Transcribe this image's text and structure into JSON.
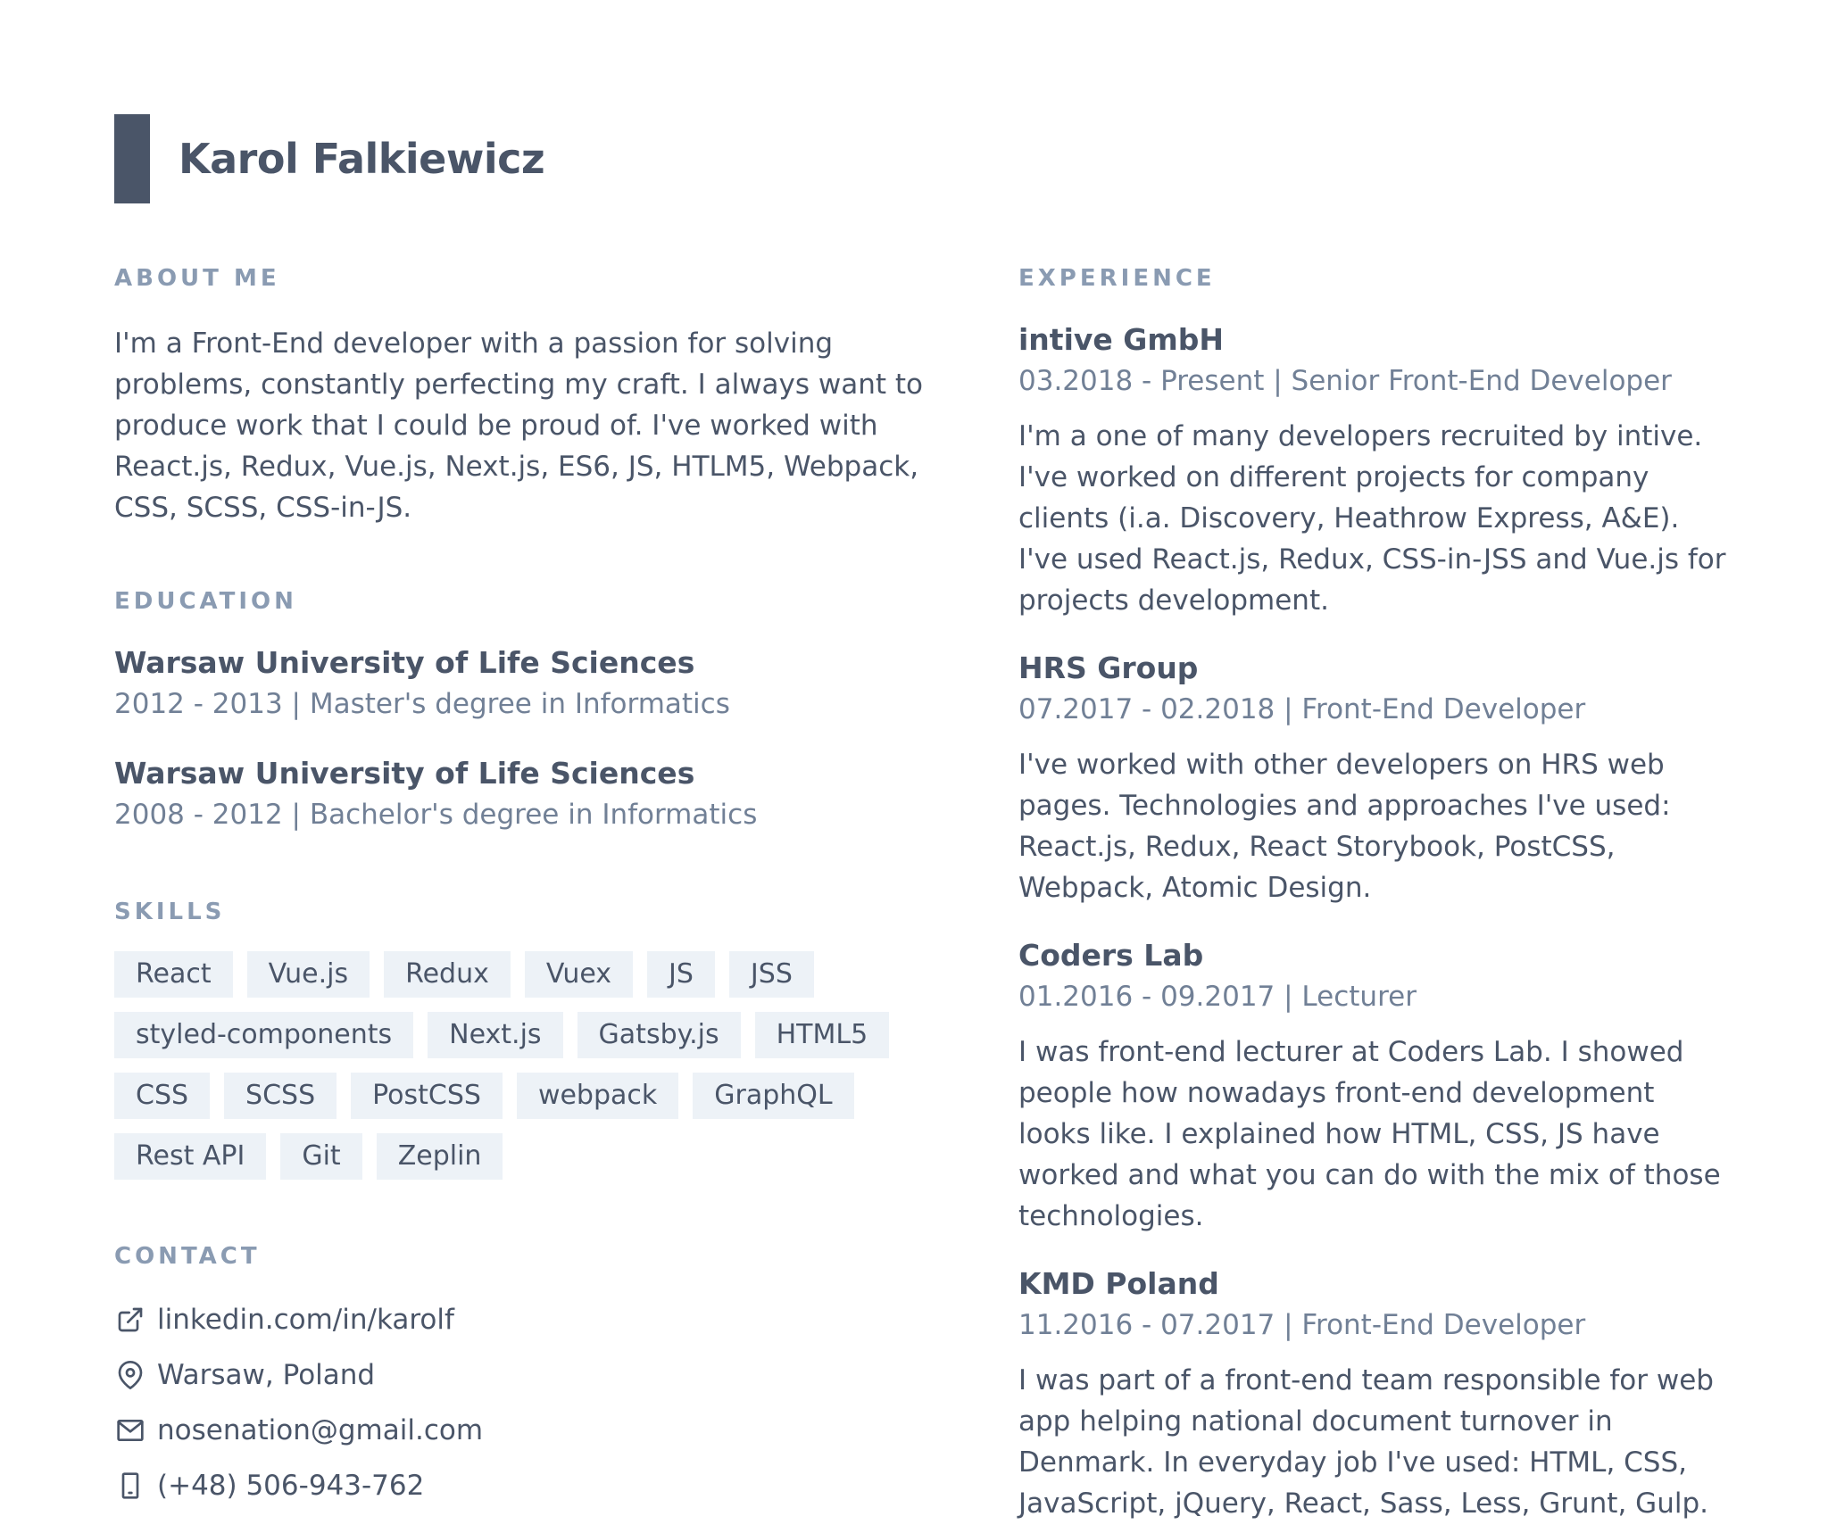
{
  "header": {
    "name": "Karol Falkiewicz"
  },
  "about": {
    "title": "About me",
    "text": "I'm a Front-End developer with a passion for solving problems, constantly perfecting my craft. I always want to produce work that I could be proud of. I've worked with React.js, Redux, Vue.js, Next.js, ES6, JS, HTLM5, Webpack, CSS, SCSS, CSS-in-JS."
  },
  "education": {
    "title": "Education",
    "items": [
      {
        "school": "Warsaw University of Life Sciences",
        "details": "2012 - 2013 | Master's degree in Informatics"
      },
      {
        "school": "Warsaw University of Life Sciences",
        "details": "2008 - 2012 | Bachelor's degree in Informatics"
      }
    ]
  },
  "skills": {
    "title": "Skills",
    "items": [
      "React",
      "Vue.js",
      "Redux",
      "Vuex",
      "JS",
      "JSS",
      "styled-components",
      "Next.js",
      "Gatsby.js",
      "HTML5",
      "CSS",
      "SCSS",
      "PostCSS",
      "webpack",
      "GraphQL",
      "Rest API",
      "Git",
      "Zeplin"
    ]
  },
  "contact": {
    "title": "Contact",
    "linkedin": "linkedin.com/in/karolf",
    "location": "Warsaw, Poland",
    "email": "nosenation@gmail.com",
    "phone": "(+48) 506-943-762",
    "icons": [
      "external-link-icon",
      "map-pin-icon",
      "mail-icon",
      "phone-icon"
    ]
  },
  "experience": {
    "title": "Experience",
    "items": [
      {
        "company": "intive GmbH",
        "details": "03.2018 - Present | Senior Front-End Developer",
        "description": "I'm a one of many developers recruited by intive. I've worked on different projects for company clients (i.a. Discovery, Heathrow Express, A&E). I've used React.js, Redux, CSS-in-JSS and Vue.js for projects development."
      },
      {
        "company": "HRS Group",
        "details": "07.2017 - 02.2018 | Front-End Developer",
        "description": "I've worked with other developers on HRS web pages. Technologies and approaches I've used: React.js, Redux, React Storybook, PostCSS, Webpack, Atomic Design."
      },
      {
        "company": "Coders Lab",
        "details": "01.2016 - 09.2017 | Lecturer",
        "description": "I was front-end lecturer at Coders Lab. I showed people how nowadays front-end development looks like. I explained how HTML, CSS, JS have worked and what you can do with the mix of those technologies."
      },
      {
        "company": "KMD Poland",
        "details": "11.2016 - 07.2017 | Front-End Developer",
        "description": "I was part of a front-end team responsible for web app helping national document turnover in Denmark. In everyday job I've used: HTML, CSS, JavaScript, jQuery, React, Sass, Less, Grunt, Gulp."
      }
    ]
  }
}
